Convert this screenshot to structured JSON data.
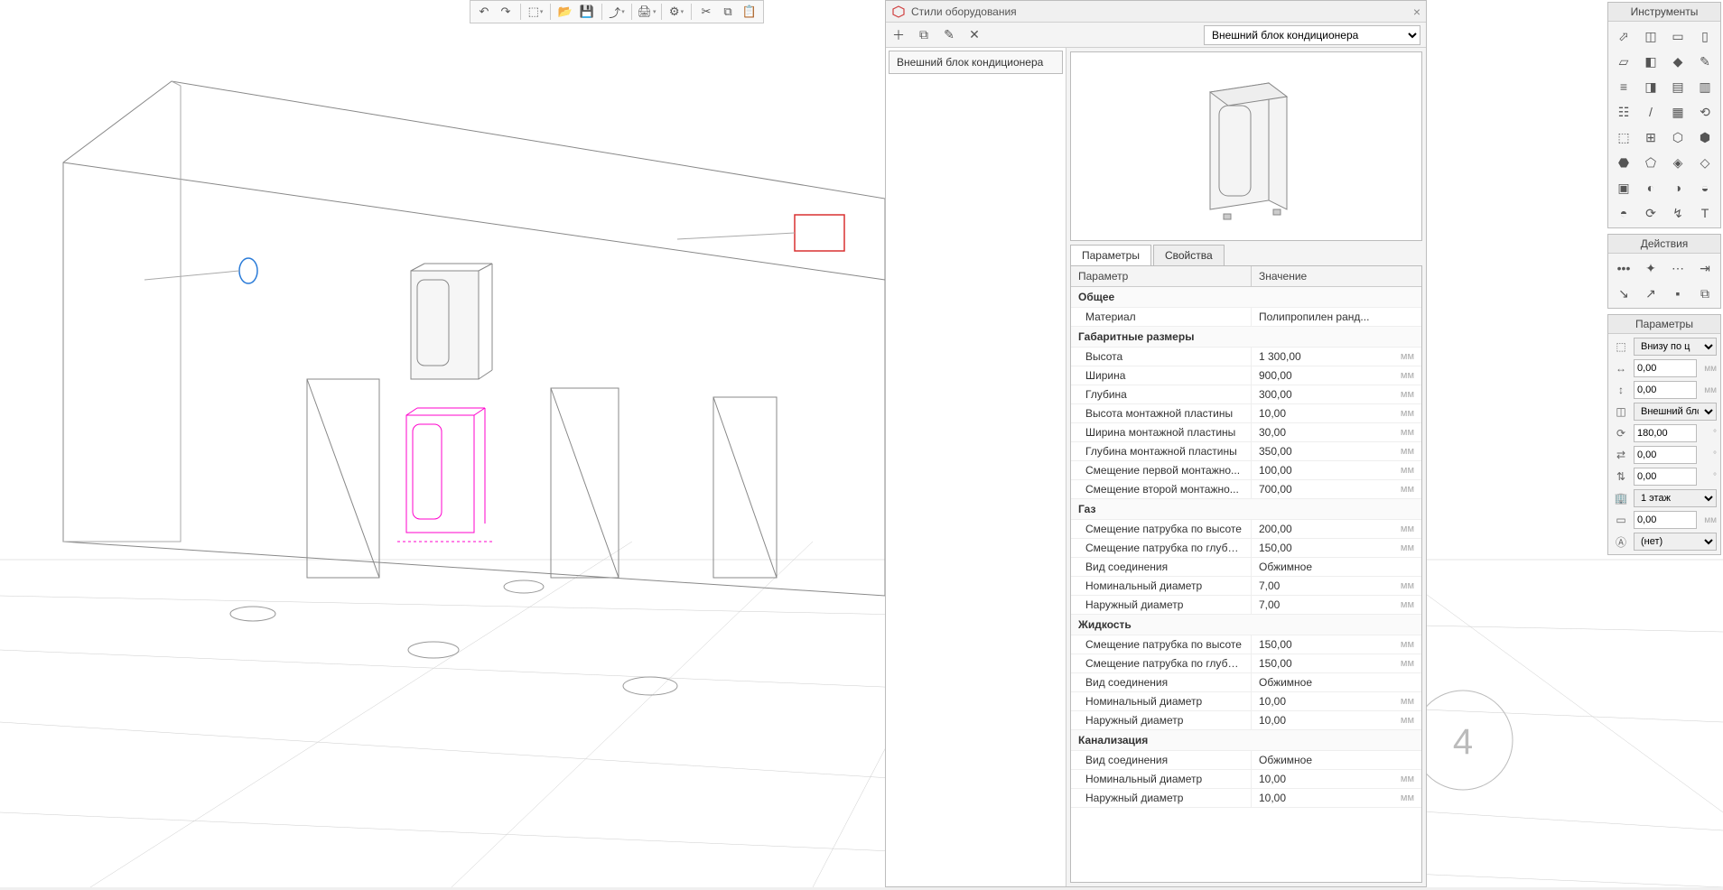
{
  "toolbar": {
    "items": [
      "undo",
      "redo",
      "",
      "home",
      "",
      "open",
      "save",
      "",
      "export",
      "",
      "print",
      "",
      "settings",
      "",
      "cut",
      "copy",
      "paste"
    ]
  },
  "eq_panel": {
    "title": "Стили оборудования",
    "dropdown": "Внешний блок кондиционера",
    "list_item": "Внешний блок кондиционера",
    "tabs": [
      "Параметры",
      "Свойства"
    ],
    "head_param": "Параметр",
    "head_value": "Значение",
    "groups": [
      {
        "name": "Общее",
        "rows": [
          {
            "p": "Материал",
            "v": "Полипропилен ранд...",
            "u": ""
          }
        ]
      },
      {
        "name": "Габаритные размеры",
        "rows": [
          {
            "p": "Высота",
            "v": "1 300,00",
            "u": "мм"
          },
          {
            "p": "Ширина",
            "v": "900,00",
            "u": "мм"
          },
          {
            "p": "Глубина",
            "v": "300,00",
            "u": "мм"
          },
          {
            "p": "Высота монтажной пластины",
            "v": "10,00",
            "u": "мм"
          },
          {
            "p": "Ширина монтажной пластины",
            "v": "30,00",
            "u": "мм"
          },
          {
            "p": "Глубина монтажной пластины",
            "v": "350,00",
            "u": "мм"
          },
          {
            "p": "Смещение первой монтажно...",
            "v": "100,00",
            "u": "мм"
          },
          {
            "p": "Смещение второй монтажно...",
            "v": "700,00",
            "u": "мм"
          }
        ]
      },
      {
        "name": "Газ",
        "rows": [
          {
            "p": "Смещение патрубка по высоте",
            "v": "200,00",
            "u": "мм"
          },
          {
            "p": "Смещение патрубка по глубине",
            "v": "150,00",
            "u": "мм"
          },
          {
            "p": "Вид соединения",
            "v": "Обжимное",
            "u": ""
          },
          {
            "p": "Номинальный диаметр",
            "v": "7,00",
            "u": "мм"
          },
          {
            "p": "Наружный диаметр",
            "v": "7,00",
            "u": "мм"
          }
        ]
      },
      {
        "name": "Жидкость",
        "rows": [
          {
            "p": "Смещение патрубка по высоте",
            "v": "150,00",
            "u": "мм"
          },
          {
            "p": "Смещение патрубка по глубине",
            "v": "150,00",
            "u": "мм"
          },
          {
            "p": "Вид соединения",
            "v": "Обжимное",
            "u": ""
          },
          {
            "p": "Номинальный диаметр",
            "v": "10,00",
            "u": "мм"
          },
          {
            "p": "Наружный диаметр",
            "v": "10,00",
            "u": "мм"
          }
        ]
      },
      {
        "name": "Канализация",
        "rows": [
          {
            "p": "Вид соединения",
            "v": "Обжимное",
            "u": ""
          },
          {
            "p": "Номинальный диаметр",
            "v": "10,00",
            "u": "мм"
          },
          {
            "p": "Наружный диаметр",
            "v": "10,00",
            "u": "мм"
          }
        ]
      }
    ]
  },
  "right": {
    "tools_title": "Инструменты",
    "actions_title": "Действия",
    "params_title": "Параметры",
    "params": {
      "placement": "Внизу по ц",
      "offset1": "0,00",
      "offset2": "0,00",
      "style": "Внешний блс",
      "angle": "180,00",
      "dx": "0,00",
      "dy": "0,00",
      "floor": "1 этаж",
      "z": "0,00",
      "mark": "(нет)"
    }
  },
  "scene": {
    "floor_number": "4"
  }
}
